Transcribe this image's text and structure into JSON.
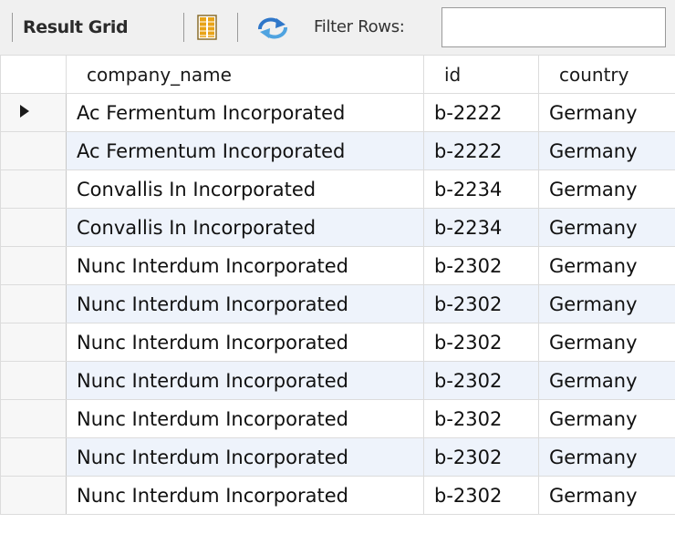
{
  "toolbar": {
    "result_grid_label": "Result Grid",
    "filter_label": "Filter Rows:",
    "filter_value": "",
    "icons": {
      "grid_icon": "grid-layout-icon",
      "refresh_icon": "refresh-arrows-icon"
    },
    "colors": {
      "icon_orange": "#e8a317",
      "icon_blue": "#2f77c9"
    }
  },
  "table": {
    "columns": [
      "company_name",
      "id",
      "country"
    ],
    "rows": [
      {
        "company_name": "Ac Fermentum Incorporated",
        "id": "b-2222",
        "country": "Germany"
      },
      {
        "company_name": "Ac Fermentum Incorporated",
        "id": "b-2222",
        "country": "Germany"
      },
      {
        "company_name": "Convallis In Incorporated",
        "id": "b-2234",
        "country": "Germany"
      },
      {
        "company_name": "Convallis In Incorporated",
        "id": "b-2234",
        "country": "Germany"
      },
      {
        "company_name": "Nunc Interdum Incorporated",
        "id": "b-2302",
        "country": "Germany"
      },
      {
        "company_name": "Nunc Interdum Incorporated",
        "id": "b-2302",
        "country": "Germany"
      },
      {
        "company_name": "Nunc Interdum Incorporated",
        "id": "b-2302",
        "country": "Germany"
      },
      {
        "company_name": "Nunc Interdum Incorporated",
        "id": "b-2302",
        "country": "Germany"
      },
      {
        "company_name": "Nunc Interdum Incorporated",
        "id": "b-2302",
        "country": "Germany"
      },
      {
        "company_name": "Nunc Interdum Incorporated",
        "id": "b-2302",
        "country": "Germany"
      },
      {
        "company_name": "Nunc Interdum Incorporated",
        "id": "b-2302",
        "country": "Germany"
      }
    ],
    "selected_row_index": 0,
    "alt_row_color": "#eef3fb"
  }
}
